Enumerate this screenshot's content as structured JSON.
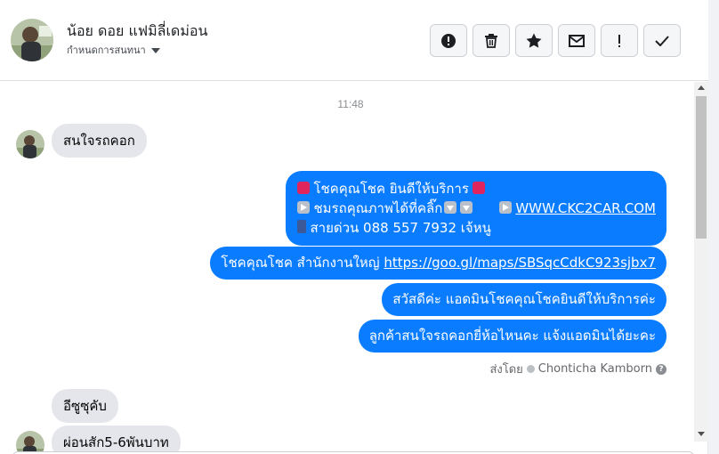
{
  "header": {
    "contact_name": "น้อย ดอย แฟมิลี่เดม่อน",
    "assign_label": "กำหนดการสนทนา",
    "actions": [
      {
        "name": "report-spam",
        "icon": "alert-circle-icon"
      },
      {
        "name": "delete",
        "icon": "trash-icon"
      },
      {
        "name": "star",
        "icon": "star-icon"
      },
      {
        "name": "mark-unread",
        "icon": "envelope-icon"
      },
      {
        "name": "follow-up",
        "icon": "exclamation-icon"
      },
      {
        "name": "mark-done",
        "icon": "check-icon"
      }
    ]
  },
  "thread": {
    "timestamp": "11:48",
    "messages": [
      {
        "direction": "in",
        "text": "สนใจรถคอก"
      },
      {
        "direction": "out",
        "lines": [
          {
            "text": "โชคคุณโชค ยินดีให้บริการ"
          },
          {
            "text": "ชมรถคุณภาพได้ที่คลิ๊ก",
            "link": "WWW.CKC2CAR.COM"
          },
          {
            "text": "สายด่วน 088 557 7932 เจ้หนู"
          }
        ]
      },
      {
        "direction": "out",
        "text": "โชคคุณโชค สำนักงานใหญ่ ",
        "link": "https://goo.gl/maps/SBSqcCdkC923sjbx7"
      },
      {
        "direction": "out",
        "text": "สวัสดีค่ะ แอดมินโชคคุณโชคยินดีให้บริการค่ะ"
      },
      {
        "direction": "out",
        "text": "ลูกค้าสนใจรถคอกยี่ห้อไหนคะ แจ้งแอดมินได้ยะคะ"
      },
      {
        "direction": "in",
        "text": "อีซูซุคับ"
      },
      {
        "direction": "in",
        "text": "ผ่อนสัก5-6พันบาท"
      }
    ],
    "sent_by_prefix": "ส่งโดย",
    "sent_by_name": "Chonticha Kamborn"
  },
  "colors": {
    "outgoing_bubble": "#0a7cff",
    "incoming_bubble": "#e4e6eb",
    "emoji_red": "#e0245e"
  }
}
